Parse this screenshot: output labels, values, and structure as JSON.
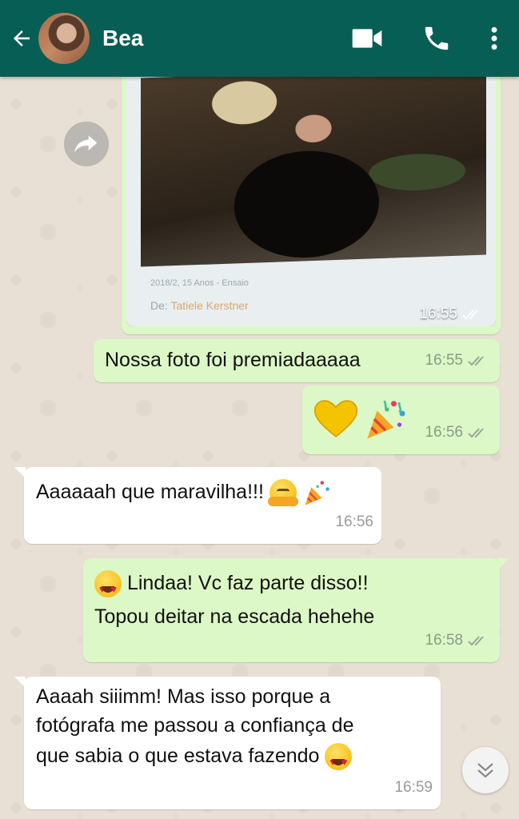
{
  "header": {
    "contact_name": "Bea"
  },
  "image_message": {
    "caption_small": "2018/2, 15 Anos - Ensaio",
    "caption_by": "De:",
    "caption_name": "Tatiele Kerstner",
    "time": "16:55"
  },
  "messages": [
    {
      "text": "Nossa foto foi premiadaaaaa",
      "time": "16:55"
    },
    {
      "time": "16:56"
    },
    {
      "text": "Aaaaaah que maravilha!!!",
      "time": "16:56"
    },
    {
      "line1": "Lindaa! Vc faz parte disso!!",
      "line2": "Topou deitar na escada hehehe",
      "time": "16:58"
    },
    {
      "line1": "Aaaah siiimm! Mas isso porque a",
      "line2": "fotógrafa me passou a confiança de",
      "line3": "que sabia o que estava fazendo",
      "time": "16:59"
    }
  ],
  "colors": {
    "header": "#075e54",
    "outgoing_bubble": "#dcf8c6",
    "incoming_bubble": "#ffffff"
  }
}
